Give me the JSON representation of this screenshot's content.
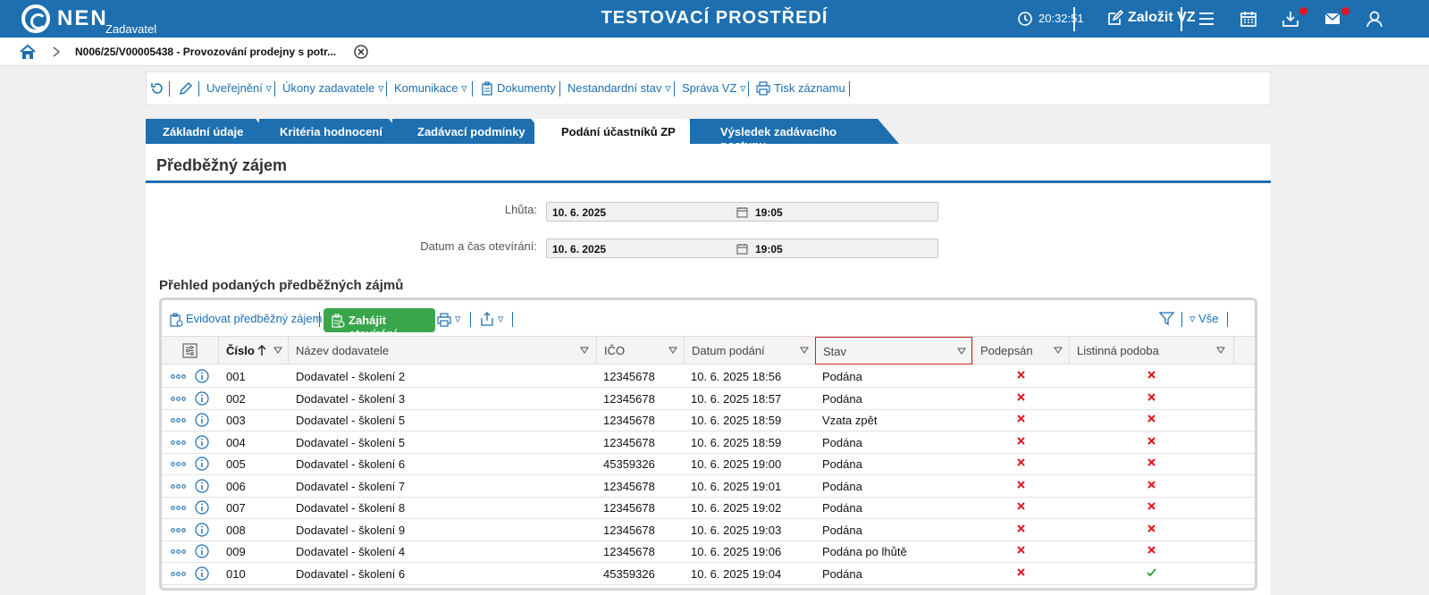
{
  "header": {
    "brand": "NEN",
    "brand_sub": "Zadavatel",
    "env_title": "TESTOVACÍ PROSTŘEDÍ",
    "time": "20:32:51",
    "create_label": "Založit VZ",
    "icons": [
      "clock-icon",
      "edit-icon",
      "menu-icon",
      "calendar-icon",
      "download-icon",
      "mail-icon",
      "user-icon"
    ]
  },
  "breadcrumb": {
    "title": "N006/25/V00005438 - Provozování prodejny s potr..."
  },
  "toolbar": {
    "uverejneni": "Uveřejnění",
    "ukony": "Úkony zadavatele",
    "komunikace": "Komunikace",
    "dokumenty": "Dokumenty",
    "nestandardni": "Nestandardní stav",
    "sprava": "Správa VZ",
    "tisk": "Tisk záznamu"
  },
  "tabs": [
    {
      "label": "Základní údaje",
      "active": false
    },
    {
      "label": "Kritéria hodnocení",
      "active": false
    },
    {
      "label": "Zadávací podmínky",
      "active": false
    },
    {
      "label": "Podání účastníků ZP",
      "active": true
    },
    {
      "label": "Výsledek zadávacího postupu",
      "active": false
    }
  ],
  "panel": {
    "title": "Předběžný zájem",
    "lhuta_label": "Lhůta:",
    "lhuta_date": "10. 6. 2025",
    "lhuta_time": "19:05",
    "otevirani_label": "Datum a čas otevírání:",
    "otevirani_date": "10. 6. 2025",
    "otevirani_time": "19:05"
  },
  "grid": {
    "title": "Přehled podaných předběžných zájmů",
    "evidovat": "Evidovat předběžný zájem",
    "zahajit": "Zahájit otevírání",
    "vse": "Vše",
    "columns": {
      "cislo": "Číslo",
      "nazev": "Název dodavatele",
      "ico": "IČO",
      "datum": "Datum podání",
      "stav": "Stav",
      "podepsan": "Podepsán",
      "listinna": "Listinná podoba"
    },
    "rows": [
      {
        "cislo": "001",
        "nazev": "Dodavatel - školení 2",
        "ico": "12345678",
        "datum": "10. 6. 2025 18:56",
        "stav": "Podána",
        "podepsan": false,
        "listinna": false
      },
      {
        "cislo": "002",
        "nazev": "Dodavatel - školení 3",
        "ico": "12345678",
        "datum": "10. 6. 2025 18:57",
        "stav": "Podána",
        "podepsan": false,
        "listinna": false
      },
      {
        "cislo": "003",
        "nazev": "Dodavatel - školení 5",
        "ico": "12345678",
        "datum": "10. 6. 2025 18:59",
        "stav": "Vzata zpět",
        "podepsan": false,
        "listinna": false
      },
      {
        "cislo": "004",
        "nazev": "Dodavatel - školení 5",
        "ico": "12345678",
        "datum": "10. 6. 2025 18:59",
        "stav": "Podána",
        "podepsan": false,
        "listinna": false
      },
      {
        "cislo": "005",
        "nazev": "Dodavatel - školení 6",
        "ico": "45359326",
        "datum": "10. 6. 2025 19:00",
        "stav": "Podána",
        "podepsan": false,
        "listinna": false
      },
      {
        "cislo": "006",
        "nazev": "Dodavatel - školení 7",
        "ico": "12345678",
        "datum": "10. 6. 2025 19:01",
        "stav": "Podána",
        "podepsan": false,
        "listinna": false
      },
      {
        "cislo": "007",
        "nazev": "Dodavatel - školení 8",
        "ico": "12345678",
        "datum": "10. 6. 2025 19:02",
        "stav": "Podána",
        "podepsan": false,
        "listinna": false
      },
      {
        "cislo": "008",
        "nazev": "Dodavatel - školení 9",
        "ico": "12345678",
        "datum": "10. 6. 2025 19:03",
        "stav": "Podána",
        "podepsan": false,
        "listinna": false
      },
      {
        "cislo": "009",
        "nazev": "Dodavatel - školení 4",
        "ico": "12345678",
        "datum": "10. 6. 2025 19:06",
        "stav": "Podána po lhůtě",
        "podepsan": false,
        "listinna": false
      },
      {
        "cislo": "010",
        "nazev": "Dodavatel - školení 6",
        "ico": "45359326",
        "datum": "10. 6. 2025 19:04",
        "stav": "Podána",
        "podepsan": false,
        "listinna": true
      }
    ]
  },
  "colors": {
    "brand_blue": "#1d6fb0",
    "start_green": "#3aa64c",
    "no_red": "#e2141e",
    "yes_green": "#2e9e3f"
  }
}
